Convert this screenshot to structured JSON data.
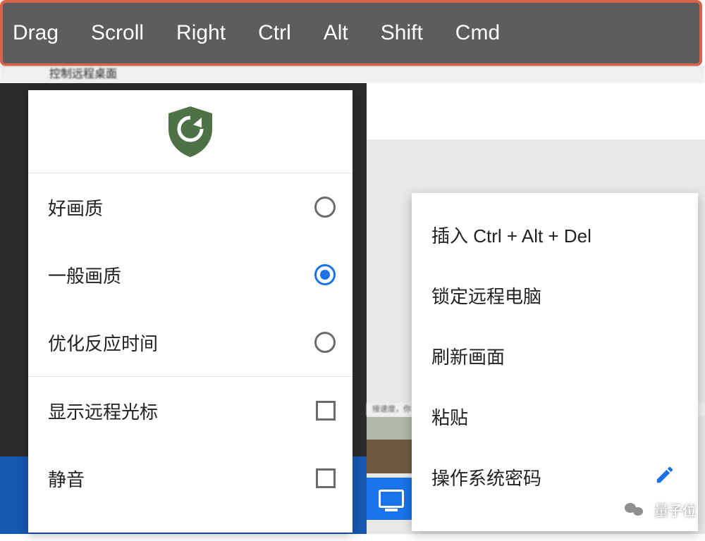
{
  "top_bar": {
    "items": [
      "Drag",
      "Scroll",
      "Right",
      "Ctrl",
      "Alt",
      "Shift",
      "Cmd"
    ],
    "partial_text_below": "控制远程桌面"
  },
  "left_panel": {
    "icon": "shield-refresh",
    "quality_options": [
      {
        "label": "好画质",
        "selected": false
      },
      {
        "label": "一般画质",
        "selected": true
      },
      {
        "label": "优化反应时间",
        "selected": false
      }
    ],
    "toggles": [
      {
        "label": "显示远程光标",
        "checked": false
      },
      {
        "label": "静音",
        "checked": false
      }
    ]
  },
  "right_menu": {
    "items": [
      {
        "label": "插入 Ctrl + Alt + Del",
        "has_edit": false
      },
      {
        "label": "锁定远程电脑",
        "has_edit": false
      },
      {
        "label": "刷新画面",
        "has_edit": false
      },
      {
        "label": "粘贴",
        "has_edit": false
      },
      {
        "label": "操作系统密码",
        "has_edit": true
      }
    ],
    "strip_text": "接速度，你"
  },
  "watermark": {
    "source": "量子位"
  },
  "colors": {
    "accent_blue": "#1a73e8",
    "highlight_border": "#d6644a",
    "shield_green": "#4e7245"
  }
}
